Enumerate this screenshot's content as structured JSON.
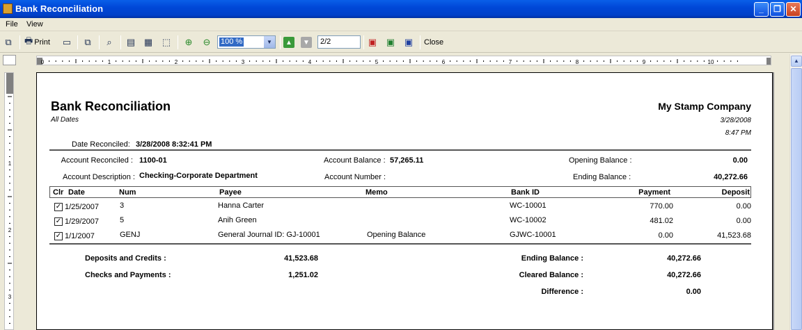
{
  "window": {
    "title": "Bank Reconciliation"
  },
  "menu": [
    "File",
    "View"
  ],
  "toolbar": {
    "print_label": "Print",
    "zoom": "100 %",
    "page": "2/2",
    "close_label": "Close"
  },
  "report": {
    "title": "Bank Reconciliation",
    "subtitle": "All Dates",
    "company": "My Stamp Company",
    "date": "3/28/2008",
    "time": "8:47 PM",
    "date_reconciled_label": "Date Reconciled:",
    "date_reconciled": "3/28/2008 8:32:41 PM",
    "account_reconciled_label": "Account Reconciled :",
    "account_reconciled": "1100-01",
    "account_balance_label": "Account Balance :",
    "account_balance": "57,265.11",
    "opening_balance_label": "Opening Balance :",
    "opening_balance": "0.00",
    "account_description_label": "Account Description :",
    "account_description": "Checking-Corporate Department",
    "account_number_label": "Account Number :",
    "ending_balance_label": "Ending Balance :",
    "ending_balance": "40,272.66",
    "columns": {
      "clr": "Clr",
      "date": "Date",
      "num": "Num",
      "payee": "Payee",
      "memo": "Memo",
      "bank_id": "Bank ID",
      "payment": "Payment",
      "deposit": "Deposit"
    },
    "rows": [
      {
        "clr": "✓",
        "date": "1/25/2007",
        "num": "3",
        "payee": "Hanna  Carter",
        "memo": "",
        "bank_id": "WC-10001",
        "payment": "770.00",
        "deposit": "0.00"
      },
      {
        "clr": "✓",
        "date": "1/29/2007",
        "num": "5",
        "payee": "Anih  Green",
        "memo": "",
        "bank_id": "WC-10002",
        "payment": "481.02",
        "deposit": "0.00"
      },
      {
        "clr": "✓",
        "date": "1/1/2007",
        "num": "GENJ",
        "payee": "General Journal ID: GJ-10001",
        "memo": "Opening Balance",
        "bank_id": "GJWC-10001",
        "payment": "0.00",
        "deposit": "41,523.68"
      }
    ],
    "totals": {
      "deposits_label": "Deposits and Credits :",
      "deposits": "41,523.68",
      "checks_label": "Checks and Payments :",
      "checks": "1,251.02",
      "ending_label": "Ending Balance :",
      "ending": "40,272.66",
      "cleared_label": "Cleared Balance :",
      "cleared": "40,272.66",
      "difference_label": "Difference :",
      "difference": "0.00"
    }
  }
}
